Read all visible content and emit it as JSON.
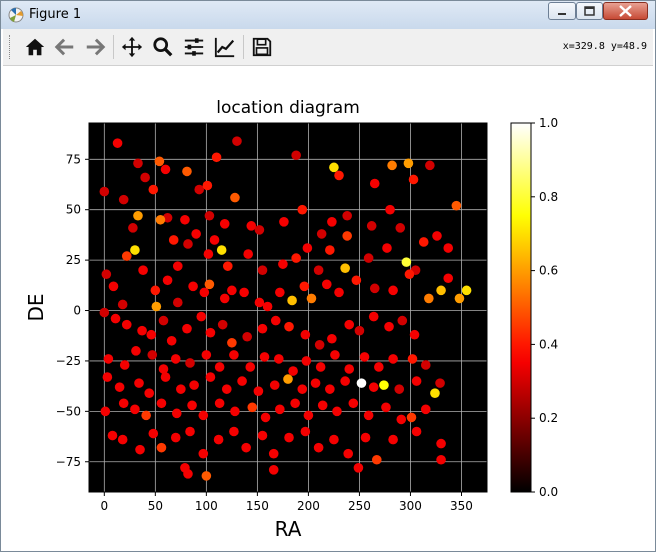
{
  "window": {
    "title": "Figure 1",
    "colors": {
      "titlebar": "#c9d9ec",
      "close": "#c74a35"
    }
  },
  "toolbar": {
    "buttons": [
      {
        "name": "home-button",
        "icon": "home-icon"
      },
      {
        "name": "back-button",
        "icon": "arrow-left-icon"
      },
      {
        "name": "forward-button",
        "icon": "arrow-right-icon"
      },
      {
        "name": "pan-button",
        "icon": "move-icon"
      },
      {
        "name": "zoom-button",
        "icon": "magnifier-icon"
      },
      {
        "name": "subplots-button",
        "icon": "sliders-icon"
      },
      {
        "name": "edit-axes-button",
        "icon": "line-chart-icon"
      },
      {
        "name": "save-button",
        "icon": "floppy-disk-icon"
      }
    ],
    "coords": "x=329.8 y=48.9"
  },
  "chart_data": {
    "type": "scatter",
    "title": "location diagram",
    "xlabel": "RA",
    "ylabel": "DE",
    "xlim": [
      -15,
      375
    ],
    "ylim": [
      -90,
      93
    ],
    "xticks": [
      0,
      50,
      100,
      150,
      200,
      250,
      300,
      350
    ],
    "yticks": [
      -75,
      -50,
      -25,
      0,
      25,
      50,
      75
    ],
    "grid": true,
    "background": "#000000",
    "colormap": "hot",
    "colorbar": {
      "range": [
        0,
        1
      ],
      "ticks": [
        "0.0",
        "0.2",
        "0.4",
        "0.6",
        "0.8",
        "1.0"
      ]
    },
    "points": [
      [
        13,
        83,
        0.35
      ],
      [
        33,
        73,
        0.3
      ],
      [
        60,
        70,
        0.35
      ],
      [
        81,
        69,
        0.5
      ],
      [
        93,
        60,
        0.3
      ],
      [
        101,
        62,
        0.4
      ],
      [
        110,
        76,
        0.4
      ],
      [
        130,
        84,
        0.3
      ],
      [
        188,
        77,
        0.3
      ],
      [
        225,
        71,
        0.7
      ],
      [
        230,
        67,
        0.4
      ],
      [
        265,
        63,
        0.35
      ],
      [
        282,
        72,
        0.55
      ],
      [
        298,
        73,
        0.6
      ],
      [
        303,
        65,
        0.4
      ],
      [
        319,
        72,
        0.3
      ],
      [
        345,
        52,
        0.5
      ],
      [
        0,
        59,
        0.3
      ],
      [
        19,
        55,
        0.3
      ],
      [
        28,
        41,
        0.3
      ],
      [
        40,
        66,
        0.3
      ],
      [
        48,
        60,
        0.4
      ],
      [
        54,
        74,
        0.5
      ],
      [
        62,
        46,
        0.3
      ],
      [
        79,
        45,
        0.35
      ],
      [
        90,
        38,
        0.35
      ],
      [
        103,
        47,
        0.3
      ],
      [
        118,
        43,
        0.35
      ],
      [
        128,
        56,
        0.5
      ],
      [
        144,
        42,
        0.35
      ],
      [
        152,
        40,
        0.3
      ],
      [
        176,
        44,
        0.35
      ],
      [
        194,
        50,
        0.4
      ],
      [
        213,
        38,
        0.3
      ],
      [
        223,
        44,
        0.35
      ],
      [
        238,
        47,
        0.3
      ],
      [
        262,
        42,
        0.3
      ],
      [
        280,
        50,
        0.35
      ],
      [
        290,
        41,
        0.3
      ],
      [
        313,
        34,
        0.4
      ],
      [
        337,
        31,
        0.35
      ],
      [
        33,
        47,
        0.6
      ],
      [
        30,
        30,
        0.7
      ],
      [
        22,
        27,
        0.45
      ],
      [
        55,
        45,
        0.55
      ],
      [
        68,
        35,
        0.4
      ],
      [
        72,
        22,
        0.35
      ],
      [
        82,
        33,
        0.3
      ],
      [
        102,
        28,
        0.35
      ],
      [
        108,
        35,
        0.35
      ],
      [
        115,
        30,
        0.7
      ],
      [
        121,
        22,
        0.4
      ],
      [
        141,
        28,
        0.35
      ],
      [
        155,
        20,
        0.3
      ],
      [
        175,
        23,
        0.35
      ],
      [
        188,
        26,
        0.4
      ],
      [
        199,
        31,
        0.35
      ],
      [
        210,
        20,
        0.3
      ],
      [
        221,
        30,
        0.4
      ],
      [
        236,
        21,
        0.65
      ],
      [
        238,
        37,
        0.45
      ],
      [
        259,
        26,
        0.3
      ],
      [
        277,
        31,
        0.35
      ],
      [
        296,
        24,
        0.8
      ],
      [
        305,
        20,
        0.3
      ],
      [
        326,
        37,
        0.35
      ],
      [
        2,
        18,
        0.3
      ],
      [
        9,
        12,
        0.35
      ],
      [
        18,
        3,
        0.3
      ],
      [
        38,
        20,
        0.35
      ],
      [
        50,
        10,
        0.4
      ],
      [
        51,
        2,
        0.6
      ],
      [
        62,
        15,
        0.35
      ],
      [
        72,
        4,
        0.3
      ],
      [
        87,
        12,
        0.35
      ],
      [
        98,
        9,
        0.35
      ],
      [
        103,
        13,
        0.5
      ],
      [
        118,
        6,
        0.35
      ],
      [
        125,
        10,
        0.35
      ],
      [
        137,
        9,
        0.35
      ],
      [
        152,
        4,
        0.35
      ],
      [
        160,
        2,
        0.35
      ],
      [
        172,
        9,
        0.35
      ],
      [
        184,
        5,
        0.65
      ],
      [
        196,
        12,
        0.4
      ],
      [
        203,
        6,
        0.55
      ],
      [
        218,
        13,
        0.35
      ],
      [
        230,
        9,
        0.35
      ],
      [
        247,
        15,
        0.4
      ],
      [
        265,
        11,
        0.3
      ],
      [
        283,
        10,
        0.35
      ],
      [
        299,
        18,
        0.4
      ],
      [
        318,
        6,
        0.55
      ],
      [
        330,
        10,
        0.65
      ],
      [
        337,
        16,
        0.35
      ],
      [
        348,
        6,
        0.6
      ],
      [
        355,
        10,
        0.7
      ],
      [
        0,
        -1,
        0.3
      ],
      [
        11,
        -4,
        0.35
      ],
      [
        22,
        -7,
        0.35
      ],
      [
        37,
        -10,
        0.35
      ],
      [
        46,
        -12,
        0.35
      ],
      [
        58,
        -5,
        0.3
      ],
      [
        66,
        -15,
        0.35
      ],
      [
        81,
        -9,
        0.35
      ],
      [
        95,
        -3,
        0.35
      ],
      [
        104,
        -11,
        0.35
      ],
      [
        116,
        -7,
        0.3
      ],
      [
        125,
        -16,
        0.45
      ],
      [
        140,
        -13,
        0.3
      ],
      [
        155,
        -9,
        0.35
      ],
      [
        168,
        -5,
        0.35
      ],
      [
        181,
        -8,
        0.4
      ],
      [
        197,
        -12,
        0.35
      ],
      [
        211,
        -17,
        0.3
      ],
      [
        223,
        -14,
        0.35
      ],
      [
        240,
        -7,
        0.35
      ],
      [
        250,
        -10,
        0.3
      ],
      [
        264,
        -3,
        0.35
      ],
      [
        279,
        -8,
        0.35
      ],
      [
        292,
        -5,
        0.3
      ],
      [
        304,
        -12,
        0.35
      ],
      [
        4,
        -24,
        0.35
      ],
      [
        20,
        -27,
        0.35
      ],
      [
        31,
        -20,
        0.35
      ],
      [
        47,
        -22,
        0.3
      ],
      [
        58,
        -29,
        0.35
      ],
      [
        70,
        -24,
        0.35
      ],
      [
        84,
        -26,
        0.3
      ],
      [
        100,
        -22,
        0.35
      ],
      [
        113,
        -28,
        0.35
      ],
      [
        127,
        -22,
        0.35
      ],
      [
        143,
        -28,
        0.35
      ],
      [
        157,
        -23,
        0.35
      ],
      [
        171,
        -24,
        0.35
      ],
      [
        185,
        -30,
        0.35
      ],
      [
        198,
        -25,
        0.35
      ],
      [
        212,
        -28,
        0.35
      ],
      [
        226,
        -22,
        0.35
      ],
      [
        240,
        -29,
        0.35
      ],
      [
        255,
        -23,
        0.35
      ],
      [
        269,
        -28,
        0.35
      ],
      [
        283,
        -24,
        0.35
      ],
      [
        302,
        -24,
        0.4
      ],
      [
        315,
        -27,
        0.3
      ],
      [
        3,
        -33,
        0.35
      ],
      [
        15,
        -38,
        0.35
      ],
      [
        34,
        -36,
        0.35
      ],
      [
        44,
        -41,
        0.35
      ],
      [
        60,
        -33,
        0.35
      ],
      [
        75,
        -39,
        0.35
      ],
      [
        88,
        -37,
        0.35
      ],
      [
        104,
        -33,
        0.35
      ],
      [
        120,
        -39,
        0.35
      ],
      [
        135,
        -35,
        0.35
      ],
      [
        151,
        -40,
        0.35
      ],
      [
        167,
        -37,
        0.35
      ],
      [
        180,
        -34,
        0.6
      ],
      [
        194,
        -39,
        0.35
      ],
      [
        207,
        -36,
        0.35
      ],
      [
        221,
        -39,
        0.35
      ],
      [
        236,
        -35,
        0.35
      ],
      [
        252,
        -36,
        1.0
      ],
      [
        264,
        -38,
        0.35
      ],
      [
        274,
        -37,
        0.75
      ],
      [
        289,
        -39,
        0.3
      ],
      [
        306,
        -35,
        0.35
      ],
      [
        324,
        -41,
        0.7
      ],
      [
        329,
        -36,
        0.3
      ],
      [
        1,
        -50,
        0.35
      ],
      [
        19,
        -46,
        0.35
      ],
      [
        30,
        -49,
        0.35
      ],
      [
        41,
        -52,
        0.45
      ],
      [
        56,
        -46,
        0.35
      ],
      [
        71,
        -51,
        0.35
      ],
      [
        86,
        -47,
        0.35
      ],
      [
        97,
        -52,
        0.35
      ],
      [
        113,
        -46,
        0.35
      ],
      [
        128,
        -50,
        0.35
      ],
      [
        145,
        -48,
        0.45
      ],
      [
        158,
        -53,
        0.35
      ],
      [
        172,
        -49,
        0.35
      ],
      [
        187,
        -46,
        0.35
      ],
      [
        200,
        -52,
        0.35
      ],
      [
        214,
        -47,
        0.35
      ],
      [
        228,
        -50,
        0.35
      ],
      [
        244,
        -46,
        0.35
      ],
      [
        259,
        -52,
        0.35
      ],
      [
        276,
        -48,
        0.35
      ],
      [
        291,
        -54,
        0.35
      ],
      [
        301,
        -53,
        0.45
      ],
      [
        315,
        -49,
        0.35
      ],
      [
        8,
        -62,
        0.35
      ],
      [
        18,
        -64,
        0.35
      ],
      [
        35,
        -69,
        0.35
      ],
      [
        48,
        -61,
        0.35
      ],
      [
        56,
        -68,
        0.45
      ],
      [
        70,
        -63,
        0.35
      ],
      [
        84,
        -60,
        0.35
      ],
      [
        97,
        -71,
        0.35
      ],
      [
        112,
        -64,
        0.35
      ],
      [
        127,
        -60,
        0.35
      ],
      [
        139,
        -68,
        0.35
      ],
      [
        155,
        -62,
        0.35
      ],
      [
        166,
        -71,
        0.35
      ],
      [
        181,
        -63,
        0.35
      ],
      [
        197,
        -60,
        0.35
      ],
      [
        210,
        -68,
        0.35
      ],
      [
        225,
        -64,
        0.35
      ],
      [
        239,
        -71,
        0.35
      ],
      [
        256,
        -63,
        0.35
      ],
      [
        267,
        -74,
        0.45
      ],
      [
        283,
        -64,
        0.35
      ],
      [
        306,
        -60,
        0.35
      ],
      [
        330,
        -66,
        0.35
      ],
      [
        330,
        -74,
        0.35
      ],
      [
        79,
        -78,
        0.35
      ],
      [
        82,
        -81,
        0.35
      ],
      [
        100,
        -82,
        0.5
      ],
      [
        166,
        -79,
        0.35
      ],
      [
        249,
        -78,
        0.35
      ]
    ]
  }
}
